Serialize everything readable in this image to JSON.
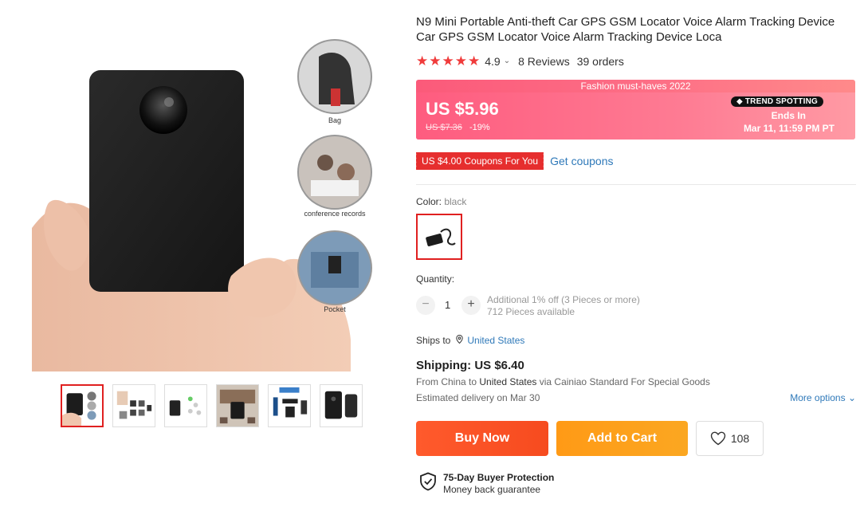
{
  "product": {
    "title": "N9 Mini Portable Anti-theft Car GPS GSM Locator Voice Alarm Tracking Device Car GPS GSM Locator Voice Alarm Tracking Device Loca",
    "rating": "4.9",
    "stars": 5,
    "reviews": "8 Reviews",
    "orders": "39 orders"
  },
  "gallery": {
    "labels": {
      "bag": "Bag",
      "conference": "conference records",
      "pocket": "Pocket"
    },
    "thumb_count": 6
  },
  "price": {
    "banner_tag": "Fashion must-haves 2022",
    "current": "US $5.96",
    "original": "US $7.36",
    "discount": "-19%",
    "badge": "TREND SPOTTING",
    "ends_label": "Ends In",
    "ends_date": "Mar 11, 11:59 PM PT"
  },
  "coupon": {
    "tag": "US $4.00 Coupons For You",
    "link": "Get coupons"
  },
  "color": {
    "label": "Color: ",
    "value": "black"
  },
  "quantity": {
    "label": "Quantity:",
    "minus": "−",
    "plus": "+",
    "value": "1",
    "note_line1": "Additional 1% off (3 Pieces or more)",
    "note_line2": "712 Pieces available"
  },
  "shipping": {
    "ships_to_label": "Ships to",
    "country": "United States",
    "title": "Shipping: US $6.40",
    "from_prefix": "From China to ",
    "from_country": "United States",
    "from_suffix": " via Cainiao Standard For Special Goods",
    "delivery": "Estimated delivery on Mar 30",
    "more_options": "More options"
  },
  "actions": {
    "buy_now": "Buy Now",
    "add_to_cart": "Add to Cart",
    "wishlist_count": "108"
  },
  "protection": {
    "title": "75-Day Buyer Protection",
    "subtitle": "Money back guarantee"
  },
  "colors": {
    "accent_red": "#e02020",
    "link_blue": "#2f79b9",
    "buy_orange": "#f64b1f",
    "cart_orange": "#fba721"
  }
}
